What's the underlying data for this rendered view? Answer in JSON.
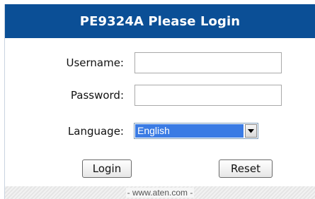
{
  "header": {
    "title": "PE9324A Please Login"
  },
  "form": {
    "username_label": "Username:",
    "username_value": "",
    "password_label": "Password:",
    "password_value": "",
    "language_label": "Language:",
    "language_selected": "English"
  },
  "buttons": {
    "login": "Login",
    "reset": "Reset"
  },
  "footer": {
    "text": "- www.aten.com -"
  },
  "icons": {
    "dropdown": "chevron-down-icon"
  },
  "colors": {
    "header_bg": "#0b4f96",
    "select_highlight": "#3a7be4"
  }
}
